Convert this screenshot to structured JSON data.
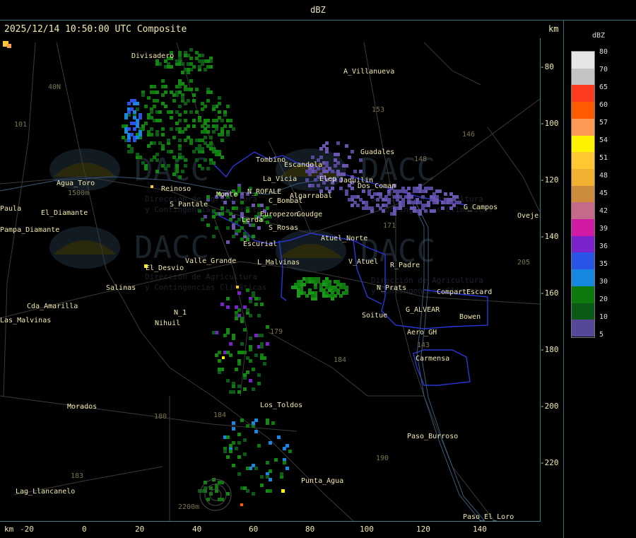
{
  "window": {
    "title": "dBZ"
  },
  "header": {
    "timestamp": "2025/12/14 10:50:00 UTC Composite",
    "unit": "km"
  },
  "colors": {
    "background": "#000000",
    "text": "#f2e9b0",
    "border": "#3b7f8a",
    "boundary": "#2a36d6"
  },
  "legend": {
    "title": "dBZ",
    "levels": [
      {
        "value": "80",
        "color": "#e6e6e6"
      },
      {
        "value": "70",
        "color": "#c4c4c4"
      },
      {
        "value": "65",
        "color": "#ff3b1f"
      },
      {
        "value": "60",
        "color": "#ff5a00"
      },
      {
        "value": "57",
        "color": "#ff9a55"
      },
      {
        "value": "54",
        "color": "#fff200"
      },
      {
        "value": "51",
        "color": "#ffc830"
      },
      {
        "value": "48",
        "color": "#f0b030"
      },
      {
        "value": "45",
        "color": "#cc8c3c"
      },
      {
        "value": "42",
        "color": "#c46a8a"
      },
      {
        "value": "39",
        "color": "#d11aa6"
      },
      {
        "value": "36",
        "color": "#7a22cc"
      },
      {
        "value": "35",
        "color": "#2a54e8"
      },
      {
        "value": "30",
        "color": "#1688e0"
      },
      {
        "value": "20",
        "color": "#0e7a0e"
      },
      {
        "value": "10",
        "color": "#0b5a16"
      },
      {
        "value": "5",
        "color": "#55479a"
      }
    ]
  },
  "axes": {
    "x_unit": "km",
    "x_ticks": [
      "-20",
      "0",
      "20",
      "40",
      "60",
      "80",
      "100",
      "120",
      "140"
    ],
    "y_ticks": [
      "-80",
      "-100",
      "-120",
      "-140",
      "-160",
      "-180",
      "-200",
      "-220"
    ]
  },
  "places": [
    "Divisadero",
    "A_Villanueva",
    "Tombino",
    "Escandola",
    "Guadales",
    "Agua_Toro",
    "Reinoso",
    "Monte",
    "N_ROFALE",
    "Algarrabal",
    "Jaquilin",
    "Dos_Coman",
    "C_Bombal",
    "G_Campos",
    "Ovejeria",
    "Pampa_Diamante",
    "Lerda",
    "Goudge",
    "S_Rosas",
    "Atuel_Norte",
    "Escurial",
    "Valle_Grande",
    "El_Desvio",
    "L_Malvinas",
    "V_Atuel",
    "R_Padre",
    "Salinas",
    "N_Prats",
    "CompartEscard",
    "Cda_Amarilla",
    "G_ALVEAR",
    "Bowen",
    "N_1",
    "Nihuil",
    "Soitue",
    "Aero_GH",
    "Carmensa",
    "Morados",
    "Los_Toldos",
    "Paso_Burroso",
    "Punta_Agua",
    "Lag_Llancanelo",
    "Paso_El_Loro",
    "Paula",
    "El_Diamante",
    "S_Pantale",
    "Europezon",
    "La_Vicia",
    "Elep",
    "Las_Malvinas"
  ],
  "route_numbers": [
    "40N",
    "101",
    "153",
    "146",
    "148",
    "171",
    "205",
    "179",
    "184",
    "180",
    "190",
    "143",
    "183",
    "184"
  ],
  "misc_labels": [
    "1500m",
    "2200m"
  ],
  "watermark": {
    "brand": "DACC",
    "line1": "Dirección de Agricultura",
    "line2": "y Contingencias Climáticas"
  }
}
